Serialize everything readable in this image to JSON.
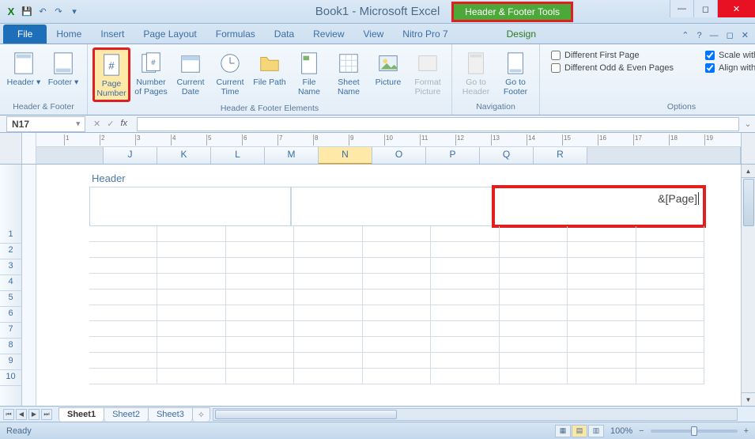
{
  "title": "Book1 - Microsoft Excel",
  "context_tab_title": "Header & Footer Tools",
  "win": {
    "min": "—",
    "max": "◻",
    "close": "✕"
  },
  "tabs": {
    "file": "File",
    "items": [
      "Home",
      "Insert",
      "Page Layout",
      "Formulas",
      "Data",
      "Review",
      "View",
      "Nitro Pro 7"
    ],
    "ctx": "Design"
  },
  "tab_help": {
    "minimize_ribbon": "⌃",
    "help": "?",
    "mdi_min": "—",
    "mdi_max": "◻",
    "mdi_close": "✕"
  },
  "ribbon": {
    "g1": {
      "label": "Header & Footer",
      "header": "Header",
      "footer": "Footer"
    },
    "g2": {
      "label": "Header & Footer Elements",
      "page_number": "Page Number",
      "number_of_pages": "Number of Pages",
      "current_date": "Current Date",
      "current_time": "Current Time",
      "file_path": "File Path",
      "file_name": "File Name",
      "sheet_name": "Sheet Name",
      "picture": "Picture",
      "format_picture": "Format Picture"
    },
    "g3": {
      "label": "Navigation",
      "goto_header": "Go to Header",
      "goto_footer": "Go to Footer"
    },
    "g4": {
      "label": "Options",
      "diff_first": "Different First Page",
      "diff_odd_even": "Different Odd & Even Pages",
      "scale": "Scale with Document",
      "align": "Align with Page Margins"
    }
  },
  "formula_bar": {
    "namebox": "N17",
    "dropdown": "▾",
    "fx": "fx"
  },
  "columns": [
    "J",
    "K",
    "L",
    "M",
    "N",
    "O",
    "P",
    "Q",
    "R"
  ],
  "ruler_numbers": [
    "1",
    "2",
    "3",
    "4",
    "5",
    "6",
    "7",
    "8",
    "9",
    "10",
    "11",
    "12",
    "13",
    "14",
    "15",
    "16",
    "17",
    "18",
    "19"
  ],
  "rows": [
    "1",
    "2",
    "3",
    "4",
    "5",
    "6",
    "7",
    "8",
    "9",
    "10"
  ],
  "header_section": {
    "label": "Header",
    "right_value": "&[Page]"
  },
  "sheet_tabs": {
    "active": "Sheet1",
    "others": [
      "Sheet2",
      "Sheet3"
    ]
  },
  "status": {
    "ready": "Ready",
    "zoom": "100%",
    "minus": "−",
    "plus": "+"
  }
}
